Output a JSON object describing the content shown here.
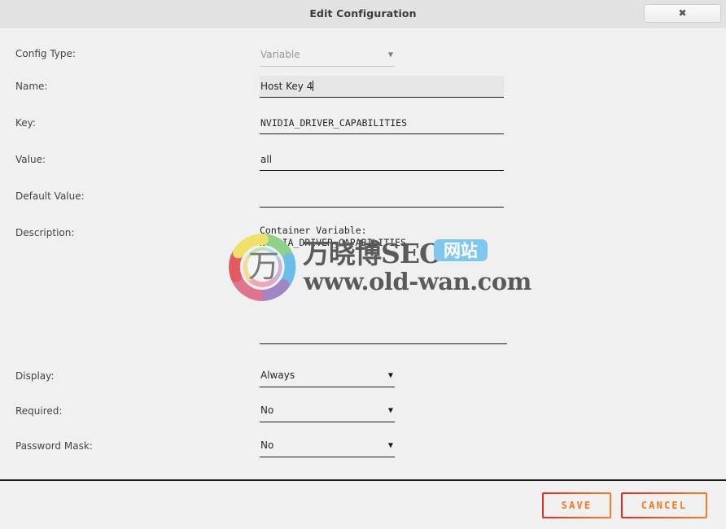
{
  "window": {
    "title": "Edit Configuration",
    "close_icon": "close-icon",
    "close_glyph": "✖"
  },
  "form": {
    "rows": [
      {
        "label": "Config Type:",
        "name": "config-type",
        "type": "select",
        "value": "Variable",
        "disabled": true,
        "arrow": "▼"
      },
      {
        "label": "Name:",
        "name": "name",
        "type": "text",
        "value": "Host Key 4",
        "focused": true
      },
      {
        "label": "Key:",
        "name": "key",
        "type": "text",
        "value": "NVIDIA_DRIVER_CAPABILITIES",
        "mono": true
      },
      {
        "label": "Value:",
        "name": "value",
        "type": "text",
        "value": "all"
      },
      {
        "label": "Default Value:",
        "name": "default-value",
        "type": "text",
        "value": ""
      },
      {
        "label": "Description:",
        "name": "description",
        "type": "textarea",
        "value": "Container Variable: NVIDIA_DRIVER_CAPABILITIES"
      },
      {
        "label": "Display:",
        "name": "display",
        "type": "select",
        "value": "Always",
        "arrow": "▼"
      },
      {
        "label": "Required:",
        "name": "required",
        "type": "select",
        "value": "No",
        "arrow": "▼"
      },
      {
        "label": "Password Mask:",
        "name": "password-mask",
        "type": "select",
        "value": "No",
        "arrow": "▼"
      }
    ]
  },
  "footer": {
    "save_label": "SAVE",
    "cancel_label": "CANCEL"
  },
  "watermark": {
    "brand_cn": "万晓博SEO",
    "badge": "网站",
    "url": "www.old-wan.com",
    "logo_char": "万"
  },
  "colors": {
    "accent_red": "#e02b23",
    "accent_orange": "#f5812c",
    "button_text": "#f07a22",
    "badge_blue": "#7ec7ef",
    "background": "#f0f0f0",
    "titlebar": "#e2e2e2",
    "field_underline": "#1d1d1d",
    "focused_field": "#e6e6e6"
  }
}
